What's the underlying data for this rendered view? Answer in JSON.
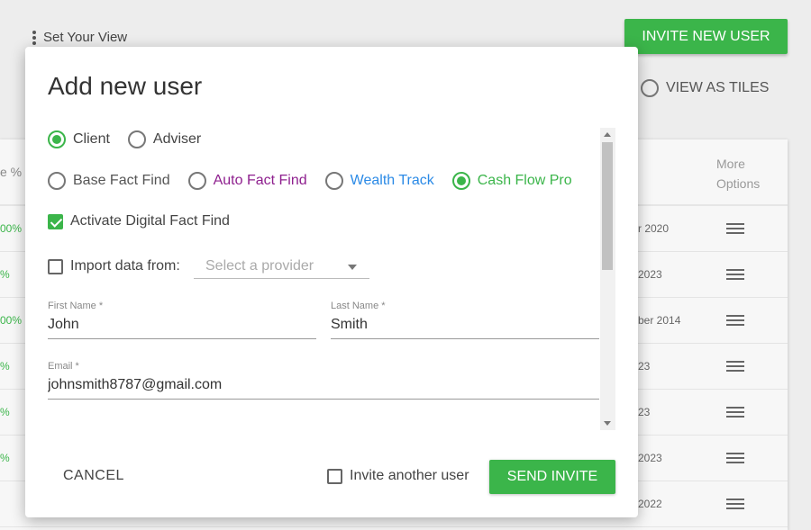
{
  "page": {
    "set_view": "Set Your View",
    "invite_button": "INVITE NEW USER",
    "view_as_tiles": "VIEW AS TILES"
  },
  "table": {
    "left_header": "e %",
    "more_options_header_1": "More",
    "more_options_header_2": "Options",
    "rows": [
      {
        "pct": "00%",
        "date": "r 2020"
      },
      {
        "pct": "%",
        "date": "2023"
      },
      {
        "pct": "00%",
        "date": "ber 2014"
      },
      {
        "pct": "%",
        "date": "23"
      },
      {
        "pct": "%",
        "date": "23"
      },
      {
        "pct": "%",
        "date": " 2023"
      },
      {
        "pct": "",
        "date": " 2022"
      }
    ]
  },
  "modal": {
    "title": "Add new user",
    "user_types": [
      {
        "label": "Client",
        "selected": true
      },
      {
        "label": "Adviser",
        "selected": false
      }
    ],
    "products": [
      {
        "label": "Base Fact Find",
        "selected": false,
        "color": "#555555"
      },
      {
        "label": "Auto Fact Find",
        "selected": false,
        "color": "#8e1f8e"
      },
      {
        "label": "Wealth Track",
        "selected": false,
        "color": "#2b8ae6"
      },
      {
        "label": "Cash Flow Pro",
        "selected": true,
        "color": "#3bb54a"
      }
    ],
    "activate_dff": {
      "label": "Activate Digital Fact Find",
      "checked": true
    },
    "import": {
      "label": "Import data from:",
      "checked": false,
      "placeholder": "Select a provider"
    },
    "first_name": {
      "label": "First Name *",
      "value": "John"
    },
    "last_name": {
      "label": "Last Name *",
      "value": "Smith"
    },
    "email": {
      "label": "Email *",
      "value": "johnsmith8787@gmail.com"
    },
    "cancel": "CANCEL",
    "invite_another": {
      "label": "Invite another user",
      "checked": false
    },
    "send": "SEND INVITE"
  },
  "colors": {
    "accent": "#3bb54a"
  }
}
